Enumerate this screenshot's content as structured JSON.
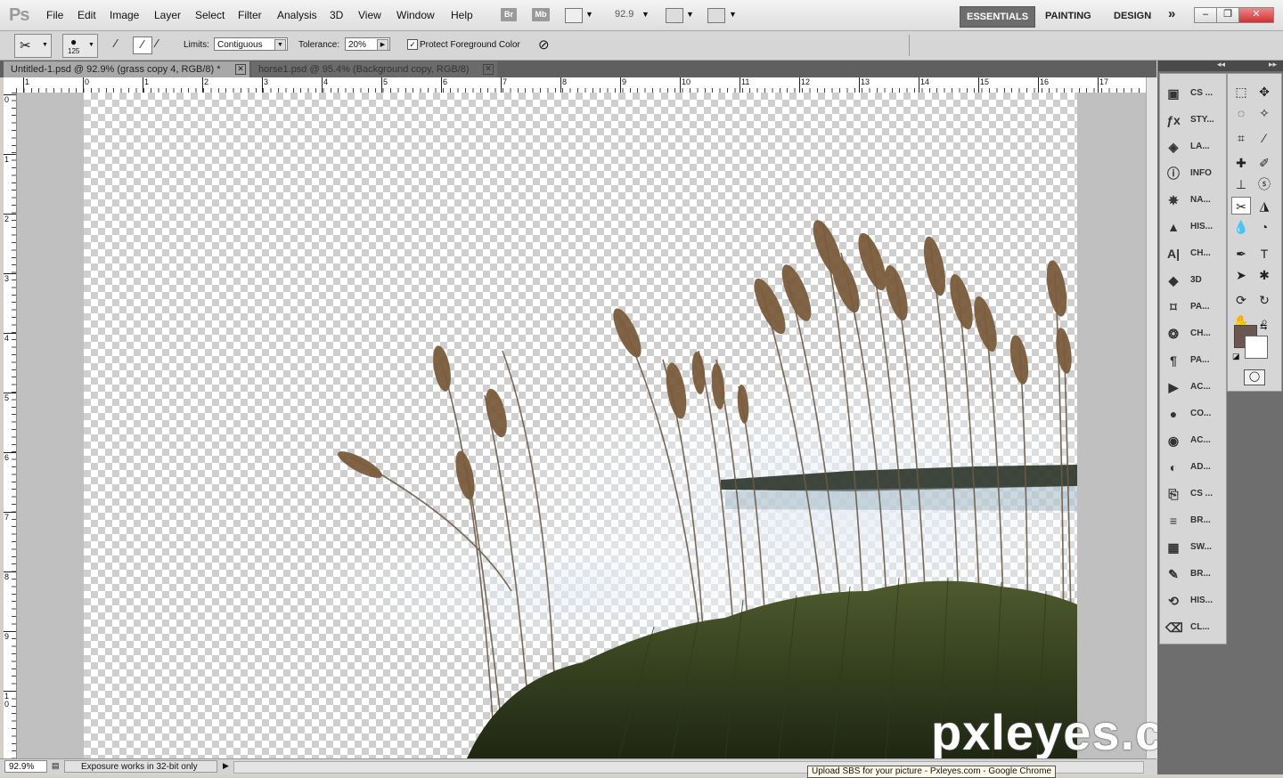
{
  "app": {
    "logo": "Ps"
  },
  "menu": [
    "File",
    "Edit",
    "Image",
    "Layer",
    "Select",
    "Filter",
    "Analysis",
    "3D",
    "View",
    "Window",
    "Help"
  ],
  "appbar": {
    "bridge": "Br",
    "minibridge": "Mb",
    "zoom": "92.9"
  },
  "workspaces": {
    "active": "ESSENTIALS",
    "others": [
      "PAINTING",
      "DESIGN"
    ],
    "more": "»"
  },
  "window_controls": {
    "minimize": "–",
    "restore": "❐",
    "close": "✕"
  },
  "options": {
    "brush_size": "125",
    "limits_label": "Limits:",
    "limits_value": "Contiguous",
    "tolerance_label": "Tolerance:",
    "tolerance_value": "20%",
    "protect_label": "Protect Foreground Color",
    "protect_checked": true
  },
  "tabs": [
    {
      "title": "Untitled-1.psd @ 92.9% (grass copy 4, RGB/8) *",
      "active": true
    },
    {
      "title": "horse1.psd @ 95.4% (Background copy, RGB/8)",
      "active": false
    }
  ],
  "ruler": {
    "top": [
      "1",
      "0",
      "1",
      "2",
      "3",
      "4",
      "5",
      "6",
      "7",
      "8",
      "9",
      "10",
      "11",
      "12",
      "13",
      "14",
      "15",
      "16",
      "17"
    ],
    "left": [
      "0",
      "1",
      "2",
      "3",
      "4",
      "5",
      "6",
      "7",
      "8",
      "9",
      "1 0"
    ]
  },
  "status": {
    "zoom": "92.9%",
    "message": "Exposure works in 32-bit only",
    "taskbar_tooltip": "Upload SBS for your picture - Pxleyes.com - Google Chrome"
  },
  "panels": [
    {
      "label": "CS ...",
      "icon": "cs-live-icon",
      "glyph": "▣"
    },
    {
      "label": "STY...",
      "icon": "styles-icon",
      "glyph": "ƒx"
    },
    {
      "label": "LA...",
      "icon": "layers-icon",
      "glyph": "◈"
    },
    {
      "label": "INFO",
      "icon": "info-icon",
      "glyph": "ⓘ"
    },
    {
      "label": "NA...",
      "icon": "navigator-icon",
      "glyph": "✵"
    },
    {
      "label": "HIS...",
      "icon": "histogram-icon",
      "glyph": "▲"
    },
    {
      "label": "CH...",
      "icon": "character-icon",
      "glyph": "A|"
    },
    {
      "label": "3D",
      "icon": "3d-icon",
      "glyph": "◆"
    },
    {
      "label": "PA...",
      "icon": "paths-icon",
      "glyph": "⌑"
    },
    {
      "label": "CH...",
      "icon": "channels-icon",
      "glyph": "❂"
    },
    {
      "label": "PA...",
      "icon": "paragraph-icon",
      "glyph": "¶"
    },
    {
      "label": "AC...",
      "icon": "actions-icon",
      "glyph": "▶"
    },
    {
      "label": "CO...",
      "icon": "color-icon",
      "glyph": "●"
    },
    {
      "label": "AC...",
      "icon": "adjustments-icon",
      "glyph": "◉"
    },
    {
      "label": "AD...",
      "icon": "adjust-icon",
      "glyph": "◐"
    },
    {
      "label": "CS ...",
      "icon": "clone-source-icon",
      "glyph": "⎘"
    },
    {
      "label": "BR...",
      "icon": "brush-presets-icon",
      "glyph": "≡"
    },
    {
      "label": "SW...",
      "icon": "swatches-icon",
      "glyph": "▦"
    },
    {
      "label": "BR...",
      "icon": "brushes-icon",
      "glyph": "✎"
    },
    {
      "label": "HIS...",
      "icon": "history-icon",
      "glyph": "⟲"
    },
    {
      "label": "CL...",
      "icon": "clone-icon",
      "glyph": "⌫"
    }
  ],
  "tools": [
    {
      "name": "marquee-tool-icon",
      "glyph": "⬚"
    },
    {
      "name": "move-tool-icon",
      "glyph": "✥"
    },
    {
      "name": "lasso-tool-icon",
      "glyph": "◌"
    },
    {
      "name": "magic-wand-tool-icon",
      "glyph": "✧"
    },
    {
      "name": "crop-tool-icon",
      "glyph": "⌗"
    },
    {
      "name": "eyedropper-tool-icon",
      "glyph": "⁄"
    },
    {
      "name": "healing-tool-icon",
      "glyph": "✚"
    },
    {
      "name": "brush-tool-icon",
      "glyph": "✐"
    },
    {
      "name": "stamp-tool-icon",
      "glyph": "⊥"
    },
    {
      "name": "history-brush-tool-icon",
      "glyph": "ⓢ"
    },
    {
      "name": "background-eraser-tool-icon",
      "glyph": "✂",
      "active": true
    },
    {
      "name": "paint-bucket-tool-icon",
      "glyph": "◮"
    },
    {
      "name": "blur-tool-icon",
      "glyph": "💧"
    },
    {
      "name": "dodge-tool-icon",
      "glyph": "◔"
    },
    {
      "name": "pen-tool-icon",
      "glyph": "✒"
    },
    {
      "name": "type-tool-icon",
      "glyph": "T"
    },
    {
      "name": "path-selection-tool-icon",
      "glyph": "➤"
    },
    {
      "name": "shape-tool-icon",
      "glyph": "✱"
    },
    {
      "name": "3d-rotate-tool-icon",
      "glyph": "⟳"
    },
    {
      "name": "3d-orbit-tool-icon",
      "glyph": "↻"
    },
    {
      "name": "hand-tool-icon",
      "glyph": "✋"
    },
    {
      "name": "zoom-tool-icon",
      "glyph": "⌕"
    }
  ],
  "colors": {
    "foreground": "#6b5652",
    "background": "#ffffff",
    "accent": "#6d6d6d"
  },
  "watermark": "pxleyes.com"
}
